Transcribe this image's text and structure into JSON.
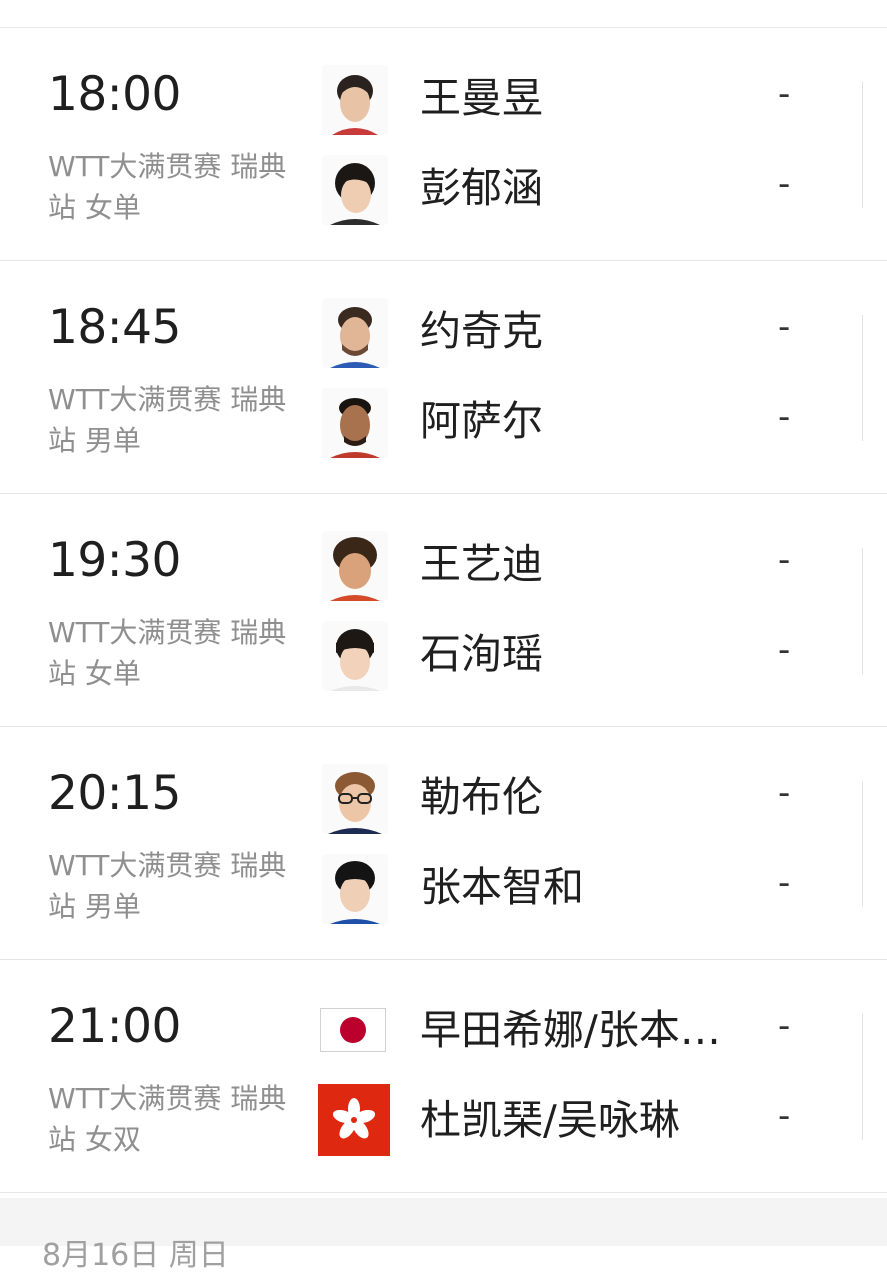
{
  "matches": [
    {
      "time": "18:00",
      "event": "WTT大满贯赛 瑞典站 女单",
      "players": [
        {
          "name": "王曼昱",
          "score": "-",
          "avatar_icon": "player-avatar-icon"
        },
        {
          "name": "彭郁涵",
          "score": "-",
          "avatar_icon": "player-avatar-icon"
        }
      ]
    },
    {
      "time": "18:45",
      "event": "WTT大满贯赛 瑞典站 男单",
      "players": [
        {
          "name": "约奇克",
          "score": "-",
          "avatar_icon": "player-avatar-icon"
        },
        {
          "name": "阿萨尔",
          "score": "-",
          "avatar_icon": "player-avatar-icon"
        }
      ]
    },
    {
      "time": "19:30",
      "event": "WTT大满贯赛 瑞典站 女单",
      "players": [
        {
          "name": "王艺迪",
          "score": "-",
          "avatar_icon": "player-avatar-icon"
        },
        {
          "name": "石洵瑶",
          "score": "-",
          "avatar_icon": "player-avatar-icon"
        }
      ]
    },
    {
      "time": "20:15",
      "event": "WTT大满贯赛 瑞典站 男单",
      "players": [
        {
          "name": "勒布伦",
          "score": "-",
          "avatar_icon": "player-avatar-icon"
        },
        {
          "name": "张本智和",
          "score": "-",
          "avatar_icon": "player-avatar-icon"
        }
      ]
    },
    {
      "time": "21:00",
      "event": "WTT大满贯赛 瑞典站 女双",
      "players": [
        {
          "name": "早田希娜/张本…",
          "score": "-",
          "avatar_icon": "japan-flag-icon"
        },
        {
          "name": "杜凯琹/吴咏琳",
          "score": "-",
          "avatar_icon": "hong-kong-flag-icon"
        }
      ]
    }
  ],
  "colors": {
    "text_primary": "#1f1f1f",
    "text_secondary": "#8f8f8f",
    "divider": "#e6e6e6",
    "japan_red": "#bc002d",
    "hong_kong_red": "#de2910"
  },
  "next_date_header": "8月16日 周日"
}
